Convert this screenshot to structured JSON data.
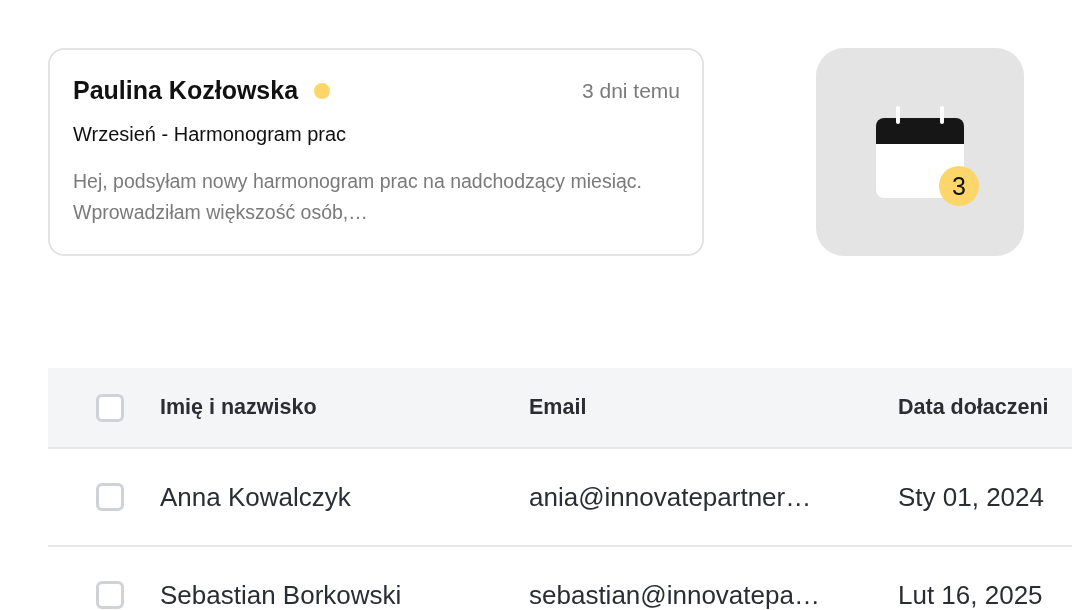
{
  "message": {
    "sender": "Paulina Kozłowska",
    "unread_dot": {
      "color": "#fcd669"
    },
    "time": "3 dni temu",
    "subject": "Wrzesień - Harmonogram prac",
    "preview": "Hej, podsyłam nowy harmonogram prac na nadchodzący miesiąc. Wprowadziłam większość osób,…"
  },
  "calendar_tile": {
    "badge": "3"
  },
  "table": {
    "select_all": {
      "checked": false
    },
    "columns": [
      "Imię i nazwisko",
      "Email",
      "Data dołaczeni"
    ],
    "rows": [
      {
        "checked": false,
        "name": "Anna Kowalczyk",
        "email": "ania@innovatepartner…",
        "date": "Sty 01, 2024"
      },
      {
        "checked": false,
        "name": "Sebastian Borkowski",
        "email": "sebastian@innovatepa…",
        "date": "Lut 16, 2025"
      }
    ]
  }
}
